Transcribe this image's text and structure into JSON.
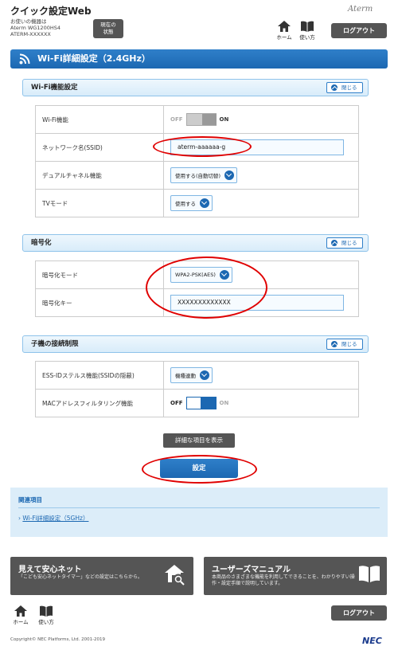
{
  "header": {
    "app_title": "クイック設定Web",
    "device_label": "お使いの機器は",
    "device_model": "Aterm WG1200HS4",
    "device_name": "ATERM-XXXXXX",
    "status_button": "現在の\n状態",
    "brand": "Aterm",
    "home_label": "ホーム",
    "help_label": "使い方",
    "logout_label": "ログアウト"
  },
  "page_title": "Wi-Fi詳細設定（2.4GHz）",
  "close_label": "閉じる",
  "sections": {
    "wifi": {
      "title": "Wi-Fi機能設定",
      "rows": {
        "wifi_function": {
          "label": "Wi-Fi機能",
          "off": "OFF",
          "on": "ON"
        },
        "ssid": {
          "label": "ネットワーク名(SSID)",
          "value": "aterm-aaaaaa-g"
        },
        "dual_channel": {
          "label": "デュアルチャネル機能",
          "value": "使用する(自動切替)"
        },
        "tv_mode": {
          "label": "TVモード",
          "value": "使用する"
        }
      }
    },
    "encryption": {
      "title": "暗号化",
      "rows": {
        "mode": {
          "label": "暗号化モード",
          "value": "WPA2-PSK(AES)"
        },
        "key": {
          "label": "暗号化キー",
          "value": "XXXXXXXXXXXXX"
        }
      }
    },
    "client": {
      "title": "子機の接続制限",
      "rows": {
        "essid_stealth": {
          "label": "ESS-IDステルス機能(SSIDの隠蔽)",
          "value": "機種連動"
        },
        "mac_filter": {
          "label": "MACアドレスフィルタリング機能",
          "off": "OFF",
          "on": "ON"
        }
      }
    }
  },
  "buttons": {
    "show_detail": "詳細な項目を表示",
    "submit": "設定"
  },
  "related": {
    "title": "関連項目",
    "link": "Wi-Fi詳細設定（5GHz）"
  },
  "cards": {
    "anshin": {
      "title": "見えて安心ネット",
      "desc": "「こども安心ネットタイマー」などの設定はこちらから。"
    },
    "manual": {
      "title": "ユーザーズマニュアル",
      "desc": "本商品のさまざまな機能を利用してできることを、わかりやすい操作・設定手順で説明しています。"
    }
  },
  "footer": {
    "home_label": "ホーム",
    "help_label": "使い方",
    "logout_label": "ログアウト",
    "copyright": "Copyright© NEC Platforms, Ltd. 2001-2019",
    "logo": "NEC"
  },
  "colors": {
    "accent": "#1c68b2",
    "dark_button": "#555555",
    "highlight_ring": "#e00000"
  }
}
